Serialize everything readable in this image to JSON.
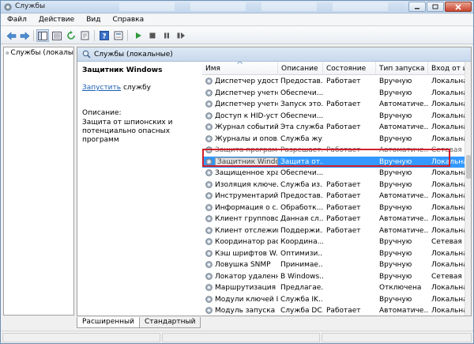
{
  "window": {
    "title": "Службы"
  },
  "menu": [
    "Файл",
    "Действие",
    "Вид",
    "Справка"
  ],
  "tree": {
    "root_label": "Службы (локалы"
  },
  "pane_header": {
    "title": "Службы (локальные)"
  },
  "desc_panel": {
    "service_name": "Защитник Windows",
    "start_link": "Запустить",
    "start_suffix": " службу",
    "desc_label": "Описание:",
    "desc_text": "Защита от шпионских и потенциально опасных программ"
  },
  "columns": [
    "Имя",
    "Описание",
    "Состояние",
    "Тип запуска",
    "Вход от и"
  ],
  "rows": [
    [
      "Диспетчер удост...",
      "Предостав...",
      "Работает",
      "Вручную",
      "Локальна"
    ],
    [
      "Диспетчер учетн...",
      "Обеспечи...",
      "",
      "Вручную",
      "Локальна"
    ],
    [
      "Диспетчер учетн...",
      "Запуск это...",
      "Работает",
      "Автоматиче...",
      "Локальна"
    ],
    [
      "Доступ к HID-уст...",
      "Обеспечи...",
      "",
      "Вручную",
      "Локальна"
    ],
    [
      "Журнал событий...",
      "Эта служба...",
      "Работает",
      "Автоматиче...",
      "Локальна"
    ],
    [
      "Журналы и опов...",
      "Служба жу...",
      "",
      "Вручную",
      "Локальна"
    ],
    [
      "Защита програм...",
      "Разрешает...",
      "Работает",
      "Автоматиче...",
      "Сетевая сл"
    ],
    [
      "Защитник Windows",
      "Защита от...",
      "",
      "Вручную",
      "Локальна"
    ],
    [
      "Защищенное хра...",
      "Обеспечи...",
      "",
      "Вручную",
      "Локальна"
    ],
    [
      "Изоляция ключе...",
      "Служба из...",
      "Работает",
      "Вручную",
      "Локальна"
    ],
    [
      "Инструментарий ...",
      "Предостав...",
      "Работает",
      "Автоматиче...",
      "Локальна"
    ],
    [
      "Информация о с...",
      "Обработк...",
      "Работает",
      "Вручную",
      "Локальна"
    ],
    [
      "Клиент группово...",
      "Данная сл...",
      "Работает",
      "Автоматиче...",
      "Локальна"
    ],
    [
      "Клиент отслежив...",
      "Поддержи...",
      "Работает",
      "Автоматиче...",
      "Локальна"
    ],
    [
      "Координатор рас...",
      "Координа...",
      "",
      "Вручную",
      "Сетевая сл"
    ],
    [
      "Кэш шрифтов W...",
      "Оптимизи...",
      "",
      "Вручную",
      "Локальна"
    ],
    [
      "Ловушка SNMP",
      "Принимае...",
      "",
      "Вручную",
      "Локальна"
    ],
    [
      "Локатор удаленн...",
      "В Windows...",
      "",
      "Вручную",
      "Сетевая сл"
    ],
    [
      "Маршрутизация ...",
      "Предлагае...",
      "",
      "Отключена",
      "Локальна"
    ],
    [
      "Модули ключей I...",
      "Служба IK...",
      "",
      "Вручную",
      "Локальна"
    ],
    [
      "Модуль запуска ...",
      "Служба DC...",
      "Работает",
      "Автоматиче...",
      "Локальна"
    ]
  ],
  "selected_row": 7,
  "tabs": [
    "Расширенный",
    "Стандартный"
  ],
  "active_tab": 0
}
